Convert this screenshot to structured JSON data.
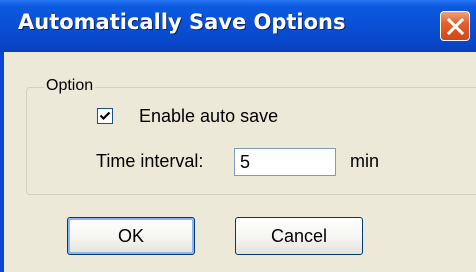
{
  "window": {
    "title": "Automatically Save Options",
    "close_icon": "close-icon"
  },
  "group": {
    "legend": "Option"
  },
  "auto_save": {
    "label": "Enable auto save",
    "checked": true
  },
  "interval": {
    "label": "Time interval:",
    "value": "5",
    "unit": "min"
  },
  "buttons": {
    "ok_label": "OK",
    "cancel_label": "Cancel"
  },
  "colors": {
    "titlebar": "#0a4fd6",
    "dialog_bg": "#ece9d8",
    "close_button": "#e2612f"
  }
}
